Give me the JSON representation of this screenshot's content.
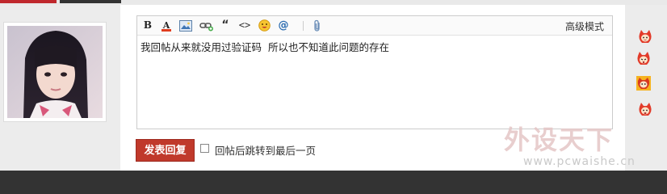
{
  "toolbar": {
    "bold_label": "B",
    "color_label": "A",
    "quote_label": "“",
    "code_label": "<>",
    "at_label": "@",
    "advanced_mode_label": "高级模式",
    "icons": [
      "bold-icon",
      "font-color-icon",
      "image-icon",
      "link-icon",
      "quote-icon",
      "code-icon",
      "smiley-icon",
      "at-icon",
      "attachment-icon"
    ]
  },
  "editor": {
    "text": "我回帖从来就没用过验证码  所以也不知道此问题的存在"
  },
  "actions": {
    "submit_label": "发表回复",
    "jump_checkbox_label": "回帖后跳转到最后一页",
    "jump_checked": false
  },
  "watermark": {
    "brand": "外设天下",
    "url": "www.pcwaishe.cn"
  },
  "colors": {
    "accent": "#c0392b",
    "bottom_bar": "#333333"
  }
}
